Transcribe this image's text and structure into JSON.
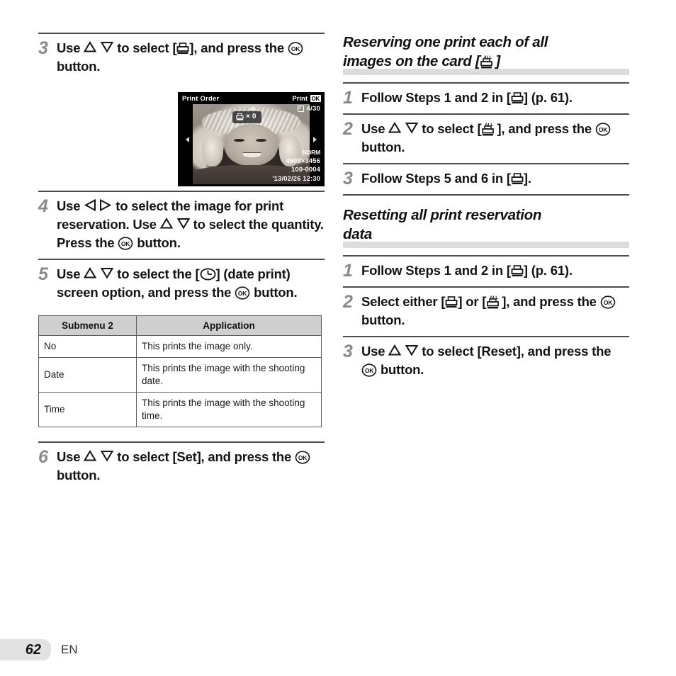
{
  "page": {
    "number": "62",
    "language_code": "EN"
  },
  "left_column": {
    "steps": [
      {
        "number": "3",
        "text_before": "Use",
        "icons": [
          "up-triangle-icon",
          "down-triangle-icon"
        ],
        "text_mid": "to select [",
        "icon_bracket": "print-order-icon",
        "text_after": "], and press the",
        "icon_ok": "ok-button-icon",
        "text_end": "button."
      },
      {
        "number": "4",
        "text_before": "Use",
        "icons": [
          "left-triangle-icon",
          "right-triangle-icon"
        ],
        "text_mid": "to select the image for print reservation. Use",
        "icons2": [
          "up-triangle-icon",
          "down-triangle-icon"
        ],
        "text_mid2": "to select the quantity. Press the",
        "icon_ok": "ok-button-icon",
        "text_end": "button."
      },
      {
        "number": "5",
        "text_before": "Use",
        "icons": [
          "up-triangle-icon",
          "down-triangle-icon"
        ],
        "text_mid": "to select the [",
        "icon_bracket": "date-print-clock-icon",
        "text_after": "] (date print) screen option, and press the",
        "icon_ok": "ok-button-icon",
        "text_end": "button."
      },
      {
        "number": "6",
        "text_before": "Use",
        "icons": [
          "up-triangle-icon",
          "down-triangle-icon"
        ],
        "text_mid": "to select [Set], and press the",
        "icon_ok": "ok-button-icon",
        "text_end": "button."
      }
    ],
    "camera_screen": {
      "title": "Print Order",
      "print_label": "Print",
      "ok_badge": "OK",
      "frame_counter": "4/30",
      "quantity_symbol": "×",
      "quantity_value": "0",
      "quality": "NORM",
      "resolution": "4608×3456",
      "file_number": "100-0004",
      "date_time": "'13/02/26  12:30"
    },
    "table": {
      "headers": [
        "Submenu 2",
        "Application"
      ],
      "rows": [
        [
          "No",
          "This prints the image only."
        ],
        [
          "Date",
          "This prints the image with the shooting date."
        ],
        [
          "Time",
          "This prints the image with the shooting time."
        ]
      ]
    }
  },
  "right_column": {
    "section1": {
      "heading_line1": "Reserving one print each of all",
      "heading_line2_before": "images on the card [",
      "heading_icon": "print-order-all-icon",
      "heading_line2_after": "]",
      "steps": [
        {
          "number": "1",
          "text_before": "Follow Steps 1 and 2 in [",
          "icon_bracket": "print-order-icon",
          "text_after": "] (p. 61)."
        },
        {
          "number": "2",
          "text_before": "Use",
          "icons": [
            "up-triangle-icon",
            "down-triangle-icon"
          ],
          "text_mid": "to select [",
          "icon_bracket": "print-order-all-icon",
          "text_after": "], and press the",
          "icon_ok": "ok-button-icon",
          "text_end": "button."
        },
        {
          "number": "3",
          "text_before": "Follow Steps 5 and 6 in [",
          "icon_bracket": "print-order-icon",
          "text_after": "]."
        }
      ]
    },
    "section2": {
      "heading_line1": "Resetting all print reservation",
      "heading_line2": "data",
      "steps": [
        {
          "number": "1",
          "text_before": "Follow Steps 1 and 2 in [",
          "icon_bracket": "print-order-icon",
          "text_after": "] (p. 61)."
        },
        {
          "number": "2",
          "text_before": "Select either [",
          "icon_bracket": "print-order-icon",
          "text_mid": "] or [",
          "icon_bracket2": "print-order-all-icon",
          "text_after": "], and press the",
          "icon_ok": "ok-button-icon",
          "text_end": "button."
        },
        {
          "number": "3",
          "text_before": "Use",
          "icons": [
            "up-triangle-icon",
            "down-triangle-icon"
          ],
          "text_mid": "to select [Reset], and press the",
          "icon_ok": "ok-button-icon",
          "text_end": "button."
        }
      ]
    }
  },
  "colors": {
    "step_number": "#8a8a8a",
    "rule": "#4b4b4b",
    "heading_bar": "#dcdcdc",
    "table_header_bg": "#cfcfcf",
    "page_tab_bg": "#e2e2e2"
  }
}
